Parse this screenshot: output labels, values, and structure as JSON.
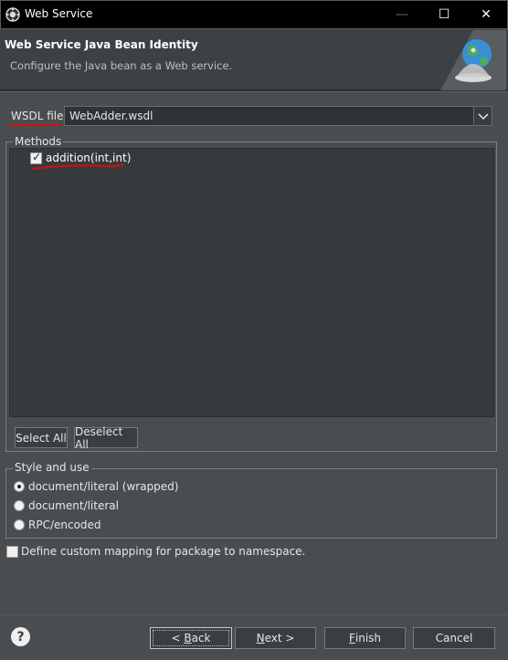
{
  "window": {
    "title": "Web Service",
    "minimize_glyph": "—",
    "maximize_glyph": "☐",
    "close_glyph": "✕",
    "icons": {
      "app": "eclipse-gear-icon",
      "header": "globe-service-bell-icon"
    }
  },
  "header": {
    "title": "Web Service Java Bean Identity",
    "description": "Configure the Java bean as a Web service."
  },
  "wsdl": {
    "label": "WSDL file:",
    "value": "WebAdder.wsdl"
  },
  "methods": {
    "group_label": "Methods",
    "items": [
      {
        "label": "addition(int,int)",
        "checked": true
      }
    ],
    "select_all": "Select All",
    "deselect_all": "Deselect All"
  },
  "style_and_use": {
    "group_label": "Style and use",
    "options": [
      {
        "label": "document/literal (wrapped)",
        "selected": true
      },
      {
        "label": "document/literal",
        "selected": false
      },
      {
        "label": "RPC/encoded",
        "selected": false
      }
    ]
  },
  "custom_mapping": {
    "label": "Define custom mapping for package to namespace.",
    "checked": false
  },
  "footer": {
    "back": {
      "prefix": "< ",
      "mnemonic": "B",
      "rest": "ack"
    },
    "next": {
      "mnemonic": "N",
      "rest": "ext >"
    },
    "finish": {
      "mnemonic": "F",
      "rest": "inish"
    },
    "cancel": "Cancel"
  },
  "colors": {
    "annotation_red": "#cf1111",
    "dialog_bg": "#4a4d50",
    "titlebar_bg": "#000000"
  }
}
